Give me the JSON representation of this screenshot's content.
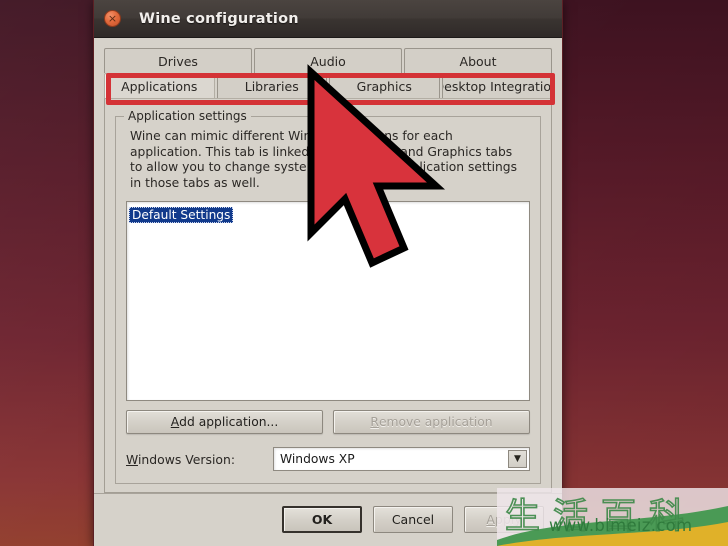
{
  "window": {
    "title": "Wine configuration",
    "close_icon": "close-icon",
    "close_glyph": "×"
  },
  "tabs": {
    "row_top": [
      {
        "label": "Drives",
        "selected": false
      },
      {
        "label": "Audio",
        "selected": false
      },
      {
        "label": "About",
        "selected": false
      }
    ],
    "row_bottom": [
      {
        "label": "Applications",
        "selected": true
      },
      {
        "label": "Libraries",
        "selected": false
      },
      {
        "label": "Graphics",
        "selected": false
      },
      {
        "label": "Desktop Integration",
        "selected": false
      }
    ]
  },
  "groupbox": {
    "title": "Application settings",
    "description": "Wine can mimic different Windows versions for each application. This tab is linked to the Library and Graphics tabs to allow you to change system-wide or per-application settings in those tabs as well."
  },
  "list": {
    "items": [
      {
        "label": "Default Settings",
        "selected": true
      }
    ]
  },
  "app_buttons": {
    "add": {
      "accel": "A",
      "rest": "dd application...",
      "disabled": false
    },
    "remove": {
      "accel": "R",
      "rest": "emove application",
      "disabled": true
    }
  },
  "version": {
    "label_accel": "W",
    "label_rest": "indows Version:",
    "value": "Windows XP",
    "arrow_icon": "chevron-down-icon",
    "arrow_glyph": "▼"
  },
  "footer": {
    "ok": "OK",
    "cancel": "Cancel",
    "apply": {
      "accel": "A",
      "rest": "pply",
      "disabled": true
    }
  },
  "annotation": {
    "highlight_color": "#d43236",
    "cursor_color": "#d8333c",
    "cursor_outline": "#000000"
  },
  "watermark": {
    "cjk": "生活百科",
    "url": "www.bimeiz.com"
  }
}
